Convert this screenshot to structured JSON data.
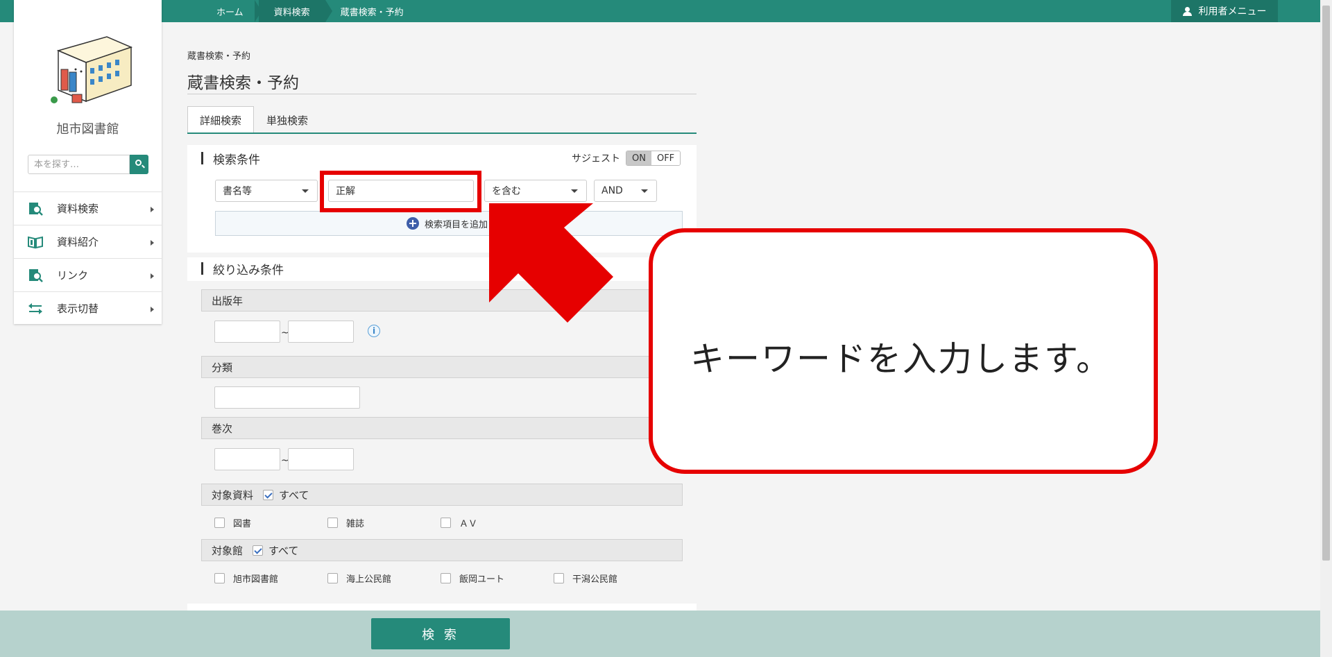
{
  "topbar": {
    "breadcrumbs": [
      "ホーム",
      "資料検索",
      "蔵書検索・予約"
    ],
    "user_menu": "利用者メニュー"
  },
  "sidebar": {
    "library_name": "旭市図書館",
    "search_placeholder": "本を探す…",
    "items": [
      {
        "label": "資料検索",
        "icon": "search-book-icon"
      },
      {
        "label": "資料紹介",
        "icon": "open-book-icon"
      },
      {
        "label": "リンク",
        "icon": "search-book-icon"
      },
      {
        "label": "表示切替",
        "icon": "swap-arrows-icon"
      }
    ]
  },
  "page": {
    "breadcrumb": "蔵書検索・予約",
    "title": "蔵書検索・予約",
    "tabs": [
      "詳細検索",
      "単独検索"
    ]
  },
  "conditions": {
    "title": "検索条件",
    "suggest_label": "サジェスト",
    "suggest_on": "ON",
    "suggest_off": "OFF",
    "field_select": "書名等",
    "keyword_value": "正解",
    "match_select": "を含む",
    "logic_select": "AND",
    "add_item": "検索項目を追加"
  },
  "filters": {
    "title": "絞り込み条件",
    "pub_year": "出版年",
    "tilde": "~",
    "classification": "分類",
    "volume": "巻次",
    "material": {
      "label": "対象資料",
      "all": "すべて",
      "options": [
        "図書",
        "雑誌",
        "ＡＶ"
      ]
    },
    "library": {
      "label": "対象館",
      "all": "すべて",
      "options": [
        "旭市図書館",
        "海上公民館",
        "飯岡ユート",
        "干潟公民館"
      ]
    }
  },
  "search_button": "検 索",
  "annotation": {
    "text": "キーワードを入力します。"
  },
  "colors": {
    "brand": "#258a7a",
    "brand_dark": "#1d7567",
    "highlight": "#e60000",
    "bottom_bar": "#b6d2cd"
  }
}
